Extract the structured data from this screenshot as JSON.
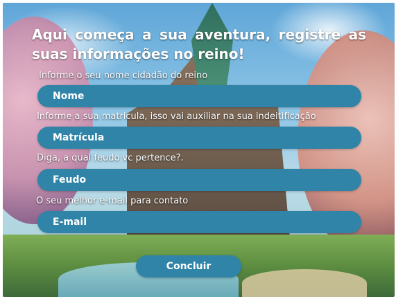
{
  "form": {
    "title": "Aqui começa a sua aventura, registre as suas informações no reino!",
    "fields": [
      {
        "label": "Informe o seu nome cidadão do reino",
        "placeholder": "Nome"
      },
      {
        "label": "Informe a sua matricula, isso vai auxiliar na sua indeitificação",
        "placeholder": "Matrícula"
      },
      {
        "label": "Diga, a qual feudo vc pertence?.",
        "placeholder": "Feudo"
      },
      {
        "label": "O seu melhor e-mail para contato",
        "placeholder": "E-mail"
      }
    ],
    "submit_label": "Concluir"
  }
}
